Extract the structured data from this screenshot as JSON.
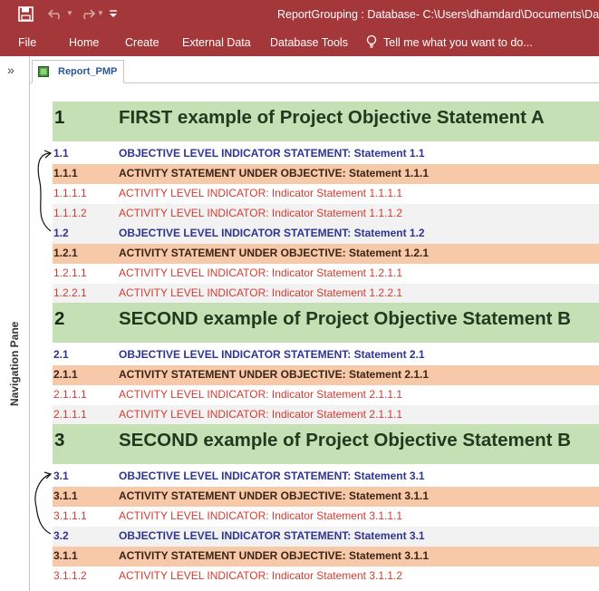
{
  "app": {
    "title": "ReportGrouping : Database- C:\\Users\\dhamdard\\Documents\\Datab",
    "accent_color": "#a4373a"
  },
  "quick_access": {
    "save_icon": "save-icon",
    "undo_icon": "undo-icon",
    "redo_icon": "redo-icon",
    "customize_icon": "customize-qat-icon"
  },
  "ribbon": {
    "tabs": [
      "File",
      "Home",
      "Create",
      "External Data",
      "Database Tools"
    ],
    "tell_me": "Tell me what you want to do..."
  },
  "nav_pane": {
    "toggle": "»",
    "label": "Navigation Pane"
  },
  "document_tab": {
    "label": "Report_PMP",
    "icon": "report-icon"
  },
  "report": {
    "rows": [
      {
        "level": 1,
        "num": "1",
        "text": "FIRST example of Project Objective Statement A"
      },
      {
        "level": 2,
        "num": "1.1",
        "text": "OBJECTIVE LEVEL INDICATOR STATEMENT:  Statement 1.1"
      },
      {
        "level": 3,
        "num": "1.1.1",
        "text": "ACTIVITY STATEMENT UNDER OBJECTIVE: Statement 1.1.1"
      },
      {
        "level": 4,
        "num": "1.1.1.1",
        "text": "ACTIVITY LEVEL INDICATOR: Indicator Statement 1.1.1.1"
      },
      {
        "level": 4,
        "num": "1.1.1.2",
        "text": "ACTIVITY LEVEL INDICATOR: Indicator Statement 1.1.1.2"
      },
      {
        "level": 2,
        "num": "1.2",
        "text": "OBJECTIVE LEVEL INDICATOR STATEMENT:  Statement 1.2"
      },
      {
        "level": 3,
        "num": "1.2.1",
        "text": "ACTIVITY STATEMENT UNDER OBJECTIVE: Statement 1.2.1"
      },
      {
        "level": 4,
        "num": "1.2.1.1",
        "text": "ACTIVITY LEVEL INDICATOR: Indicator Statement 1.2.1.1"
      },
      {
        "level": 4,
        "num": "1.2.2.1",
        "text": "ACTIVITY LEVEL INDICATOR: Indicator Statement 1.2.2.1"
      },
      {
        "level": 1,
        "num": "2",
        "text": "SECOND example of Project Objective Statement B"
      },
      {
        "level": 2,
        "num": "2.1",
        "text": "OBJECTIVE LEVEL INDICATOR STATEMENT:  Statement 2.1"
      },
      {
        "level": 3,
        "num": "2.1.1",
        "text": "ACTIVITY STATEMENT UNDER OBJECTIVE: Statement 2.1.1"
      },
      {
        "level": 4,
        "num": "2.1.1.1",
        "text": "ACTIVITY LEVEL INDICATOR: Indicator Statement 2.1.1.1"
      },
      {
        "level": 4,
        "num": "2.1.1.1",
        "text": "ACTIVITY LEVEL INDICATOR: Indicator Statement 2.1.1.1"
      },
      {
        "level": 1,
        "num": "3",
        "text": "SECOND example of Project Objective Statement B"
      },
      {
        "level": 2,
        "num": "3.1",
        "text": "OBJECTIVE LEVEL INDICATOR STATEMENT:  Statement 3.1"
      },
      {
        "level": 3,
        "num": "3.1.1",
        "text": "ACTIVITY STATEMENT UNDER OBJECTIVE: Statement 3.1.1"
      },
      {
        "level": 4,
        "num": "3.1.1.1",
        "text": "ACTIVITY LEVEL INDICATOR: Indicator Statement 3.1.1.1"
      },
      {
        "level": 2,
        "num": "3.2",
        "text": "OBJECTIVE LEVEL INDICATOR STATEMENT:  Statement 3.1"
      },
      {
        "level": 3,
        "num": "3.1.1",
        "text": "ACTIVITY STATEMENT UNDER OBJECTIVE: Statement 3.1.1"
      },
      {
        "level": 4,
        "num": "3.1.1.2",
        "text": "ACTIVITY LEVEL INDICATOR: Indicator Statement 3.1.1.2"
      }
    ],
    "colors": {
      "objective_band": "#c5e0b4",
      "indicator_text": "#2f3592",
      "activity_band": "#f7c9a9",
      "activity_indicator_text": "#d23b30"
    }
  },
  "annotations": [
    "bracket-arrow",
    "bracket-arrow"
  ]
}
